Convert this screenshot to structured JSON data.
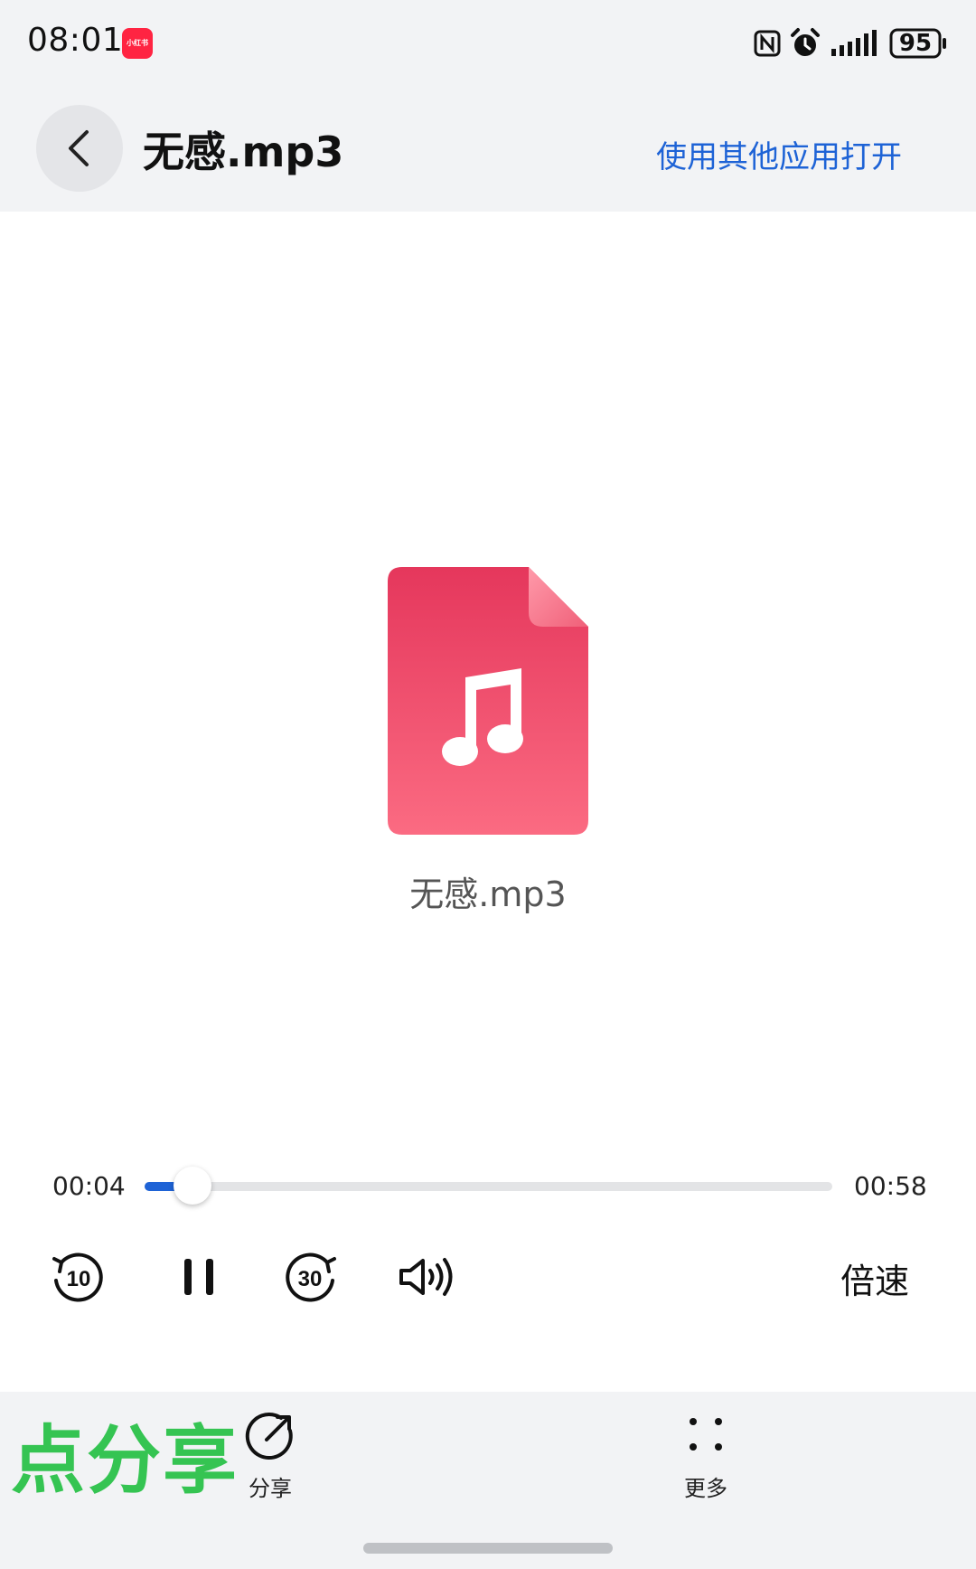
{
  "status_bar": {
    "time": "08:01",
    "app_badge": "小红书",
    "battery_level": "95",
    "icons": [
      "nfc-icon",
      "alarm-icon",
      "signal-icon",
      "battery-icon"
    ]
  },
  "header": {
    "title": "无感.mp3",
    "open_with_label": "使用其他应用打开"
  },
  "preview": {
    "file_name": "无感.mp3",
    "icon": "music-file-icon",
    "icon_color": "#f0546e"
  },
  "player": {
    "elapsed": "00:04",
    "total": "00:58",
    "progress_fraction": 0.069,
    "speed_label": "倍速",
    "rewind_label": "10",
    "forward_label": "30",
    "accent_color": "#1e63d6"
  },
  "bottom_bar": {
    "hint_text": "点分享",
    "share_label": "分享",
    "more_label": "更多",
    "hint_color": "#35c452"
  }
}
